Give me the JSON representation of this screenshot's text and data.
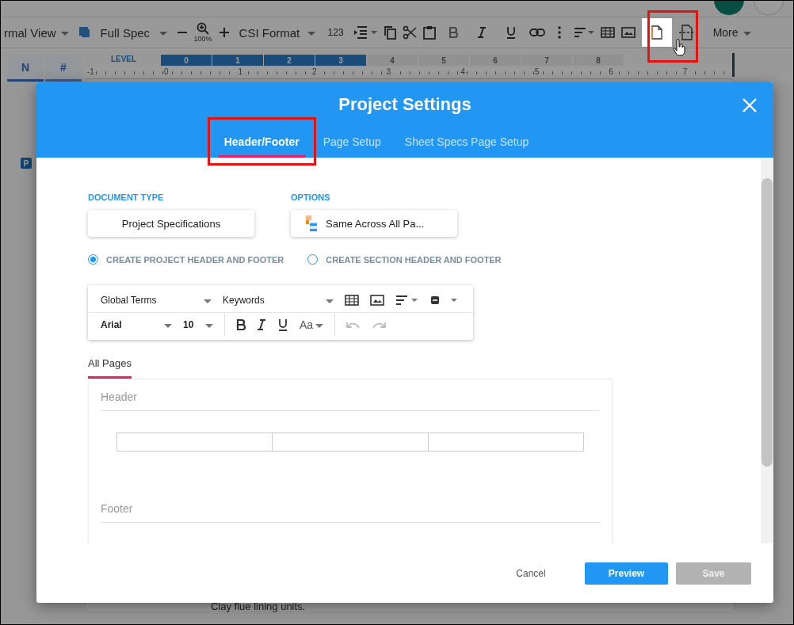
{
  "toolbar": {
    "view": "rmal View",
    "document": "Full Spec",
    "zoom": "100%",
    "format": "CSI Format",
    "numbering": "123",
    "more": "More"
  },
  "left_tabs": [
    {
      "label": "N",
      "selected": true
    },
    {
      "label": "#",
      "selected": false
    }
  ],
  "badge": "P",
  "ruler": {
    "level_label": "LEVEL",
    "levels": [
      {
        "label": "0",
        "active": true
      },
      {
        "label": "1",
        "active": true
      },
      {
        "label": "2",
        "active": true
      },
      {
        "label": "3",
        "active": true
      },
      {
        "label": "4",
        "active": false
      },
      {
        "label": "5",
        "active": false
      },
      {
        "label": "6",
        "active": false
      },
      {
        "label": "7",
        "active": false
      },
      {
        "label": "8",
        "active": false
      }
    ],
    "marks": [
      "-1",
      "0",
      "1",
      "2",
      "3",
      "4",
      "5",
      "6",
      "7"
    ]
  },
  "document_text": "Clay flue lining units.",
  "dialog": {
    "title": "Project Settings",
    "tabs": [
      {
        "label": "Header/Footer",
        "selected": true
      },
      {
        "label": "Page Setup",
        "selected": false
      },
      {
        "label": "Sheet Specs Page Setup",
        "selected": false
      }
    ],
    "document_type": {
      "label": "DOCUMENT TYPE",
      "value": "Project Specifications"
    },
    "options": {
      "label": "OPTIONS",
      "value": "Same Across All Pa..."
    },
    "scope": [
      {
        "label": "CREATE PROJECT HEADER AND FOOTER",
        "selected": true
      },
      {
        "label": "CREATE SECTION HEADER AND FOOTER",
        "selected": false
      }
    ],
    "editor": {
      "global_terms": "Global Terms",
      "keywords": "Keywords",
      "font": "Arial",
      "size": "10",
      "case": "Aa"
    },
    "page_tabs": [
      {
        "label": "All Pages",
        "selected": true
      }
    ],
    "header_label": "Header",
    "footer_label": "Footer",
    "buttons": [
      {
        "label": "Cancel",
        "kind": "text",
        "disabled": false
      },
      {
        "label": "Preview",
        "kind": "primary",
        "disabled": false
      },
      {
        "label": "Save",
        "kind": "primary",
        "disabled": true
      }
    ]
  }
}
